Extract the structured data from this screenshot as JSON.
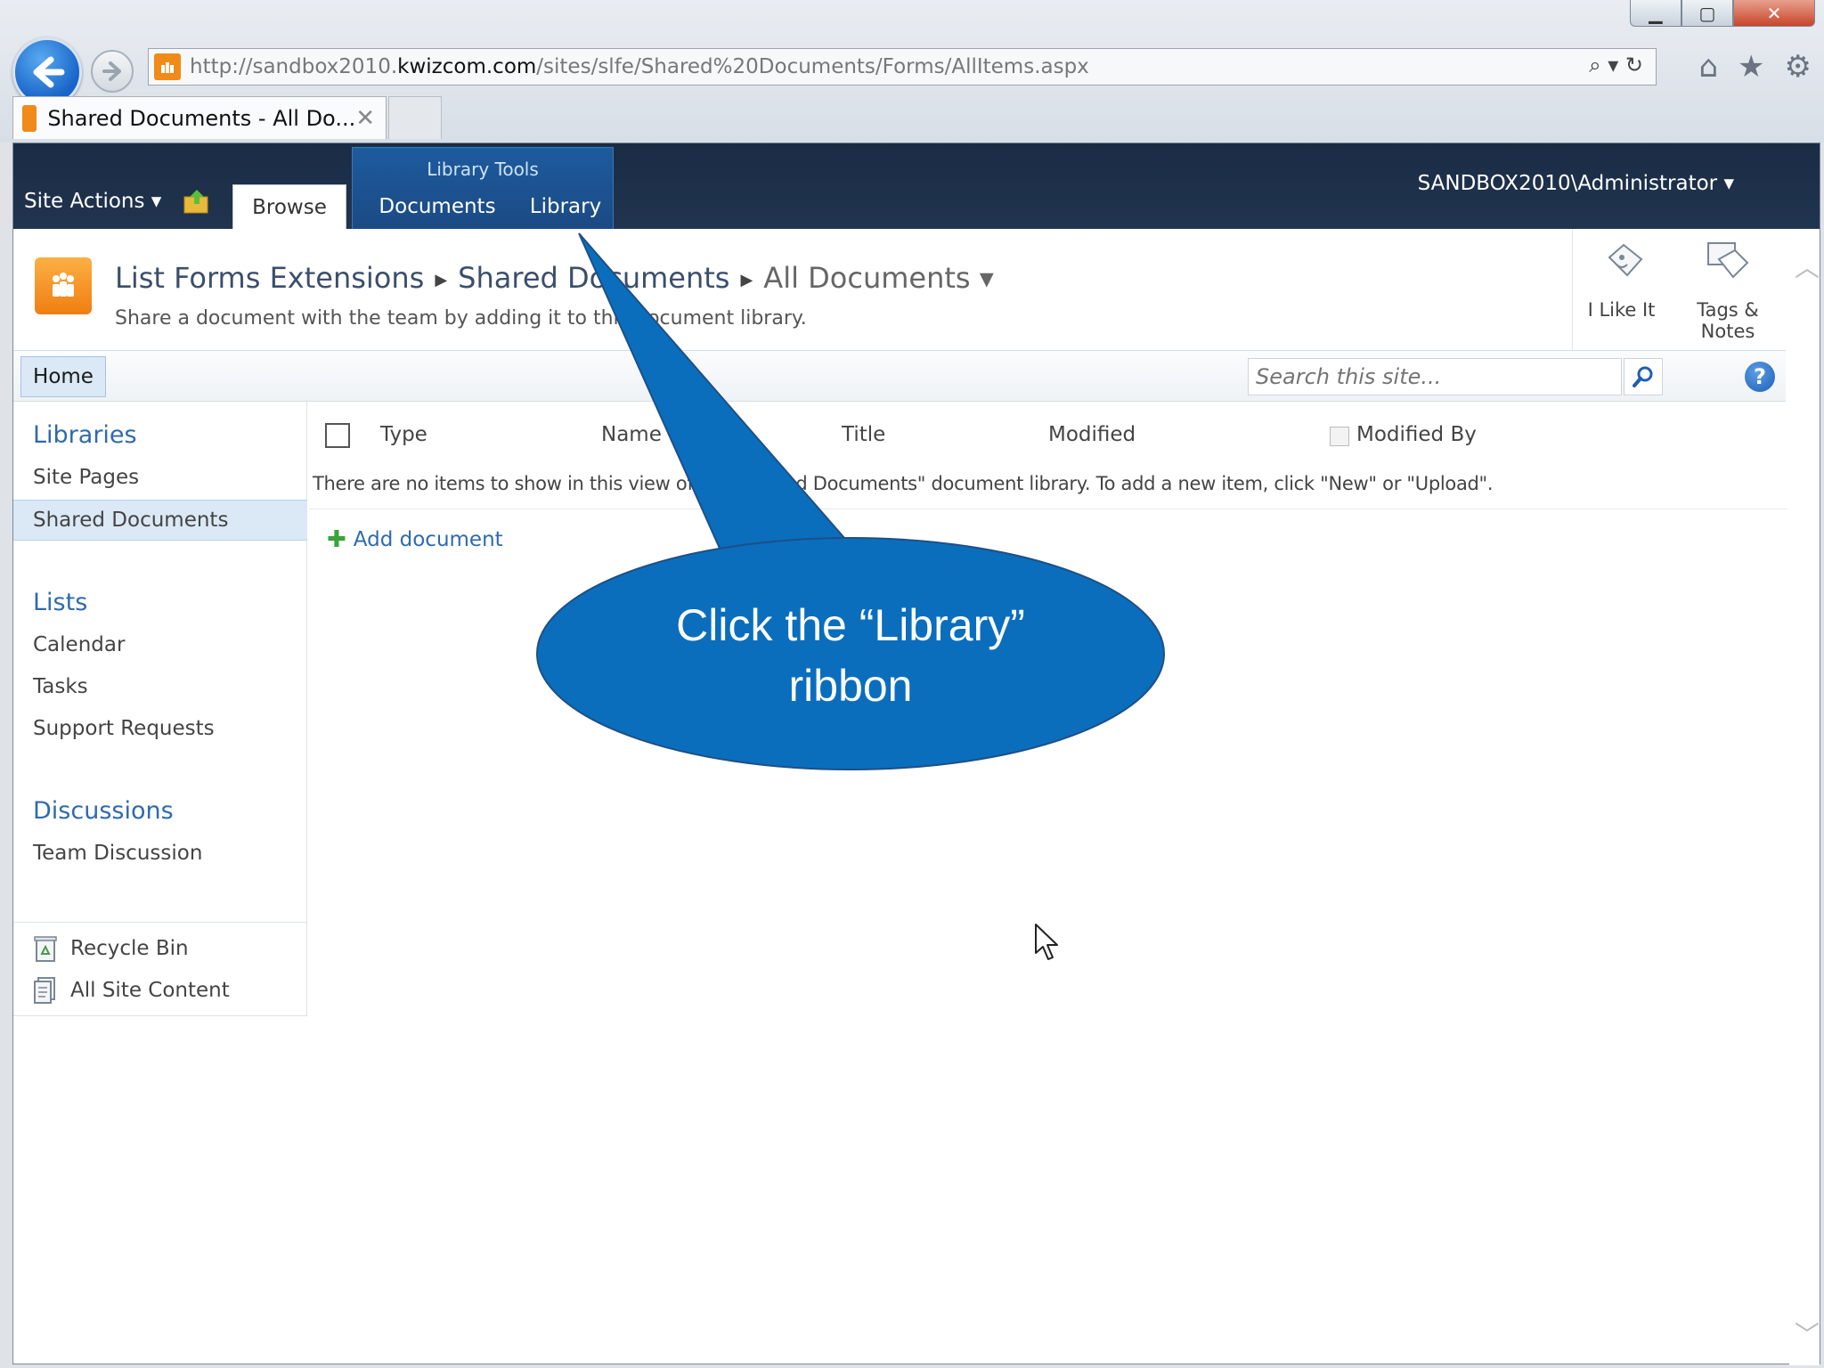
{
  "browser": {
    "url_prefix": "http://sandbox2010.",
    "url_host": "kwizcom.com",
    "url_path": "/sites/slfe/Shared%20Documents/Forms/AllItems.aspx",
    "address_tools": "⌕ ▾ ↻",
    "tab_title": "Shared Documents - All Do...",
    "tab_close": "✕",
    "window_controls": {
      "minimize": "▁",
      "maximize": "▢",
      "close": "✕"
    }
  },
  "ribbon": {
    "site_actions": "Site Actions ▾",
    "tabs": {
      "browse": "Browse",
      "documents": "Documents",
      "library": "Library"
    },
    "tool_group_label": "Library Tools",
    "user": "SANDBOX2010\\Administrator ▾"
  },
  "title_area": {
    "crumbs": [
      "List Forms Extensions",
      "Shared Documents",
      "All Documents ▾"
    ],
    "description": "Share a document with the team by adding it to this document library.",
    "social": {
      "like": "I Like It",
      "tags_line1": "Tags &",
      "tags_line2": "Notes"
    }
  },
  "topnav": {
    "home": "Home",
    "search_placeholder": "Search this site...",
    "help": "?"
  },
  "quicklaunch": {
    "libraries_head": "Libraries",
    "libraries": [
      "Site Pages",
      "Shared Documents"
    ],
    "lists_head": "Lists",
    "lists": [
      "Calendar",
      "Tasks",
      "Support Requests"
    ],
    "discussions_head": "Discussions",
    "discussions": [
      "Team Discussion"
    ],
    "recycle_bin": "Recycle Bin",
    "all_site_content": "All Site Content"
  },
  "list": {
    "columns": [
      "Type",
      "Name",
      "Title",
      "Modified",
      "Modified By"
    ],
    "empty_message": "There are no items to show in this view of the \"Shared Documents\" document library. To add a new item, click \"New\" or \"Upload\".",
    "add_document": "Add document"
  },
  "callout": {
    "line1": "Click the “Library”",
    "line2": "ribbon",
    "fill": "#0a6ebd"
  },
  "colors": {
    "ribbon_bg": "#1a2c44",
    "tool_group": "#1d5b9e",
    "link": "#2e6ab0",
    "logo": "#f08a18"
  }
}
